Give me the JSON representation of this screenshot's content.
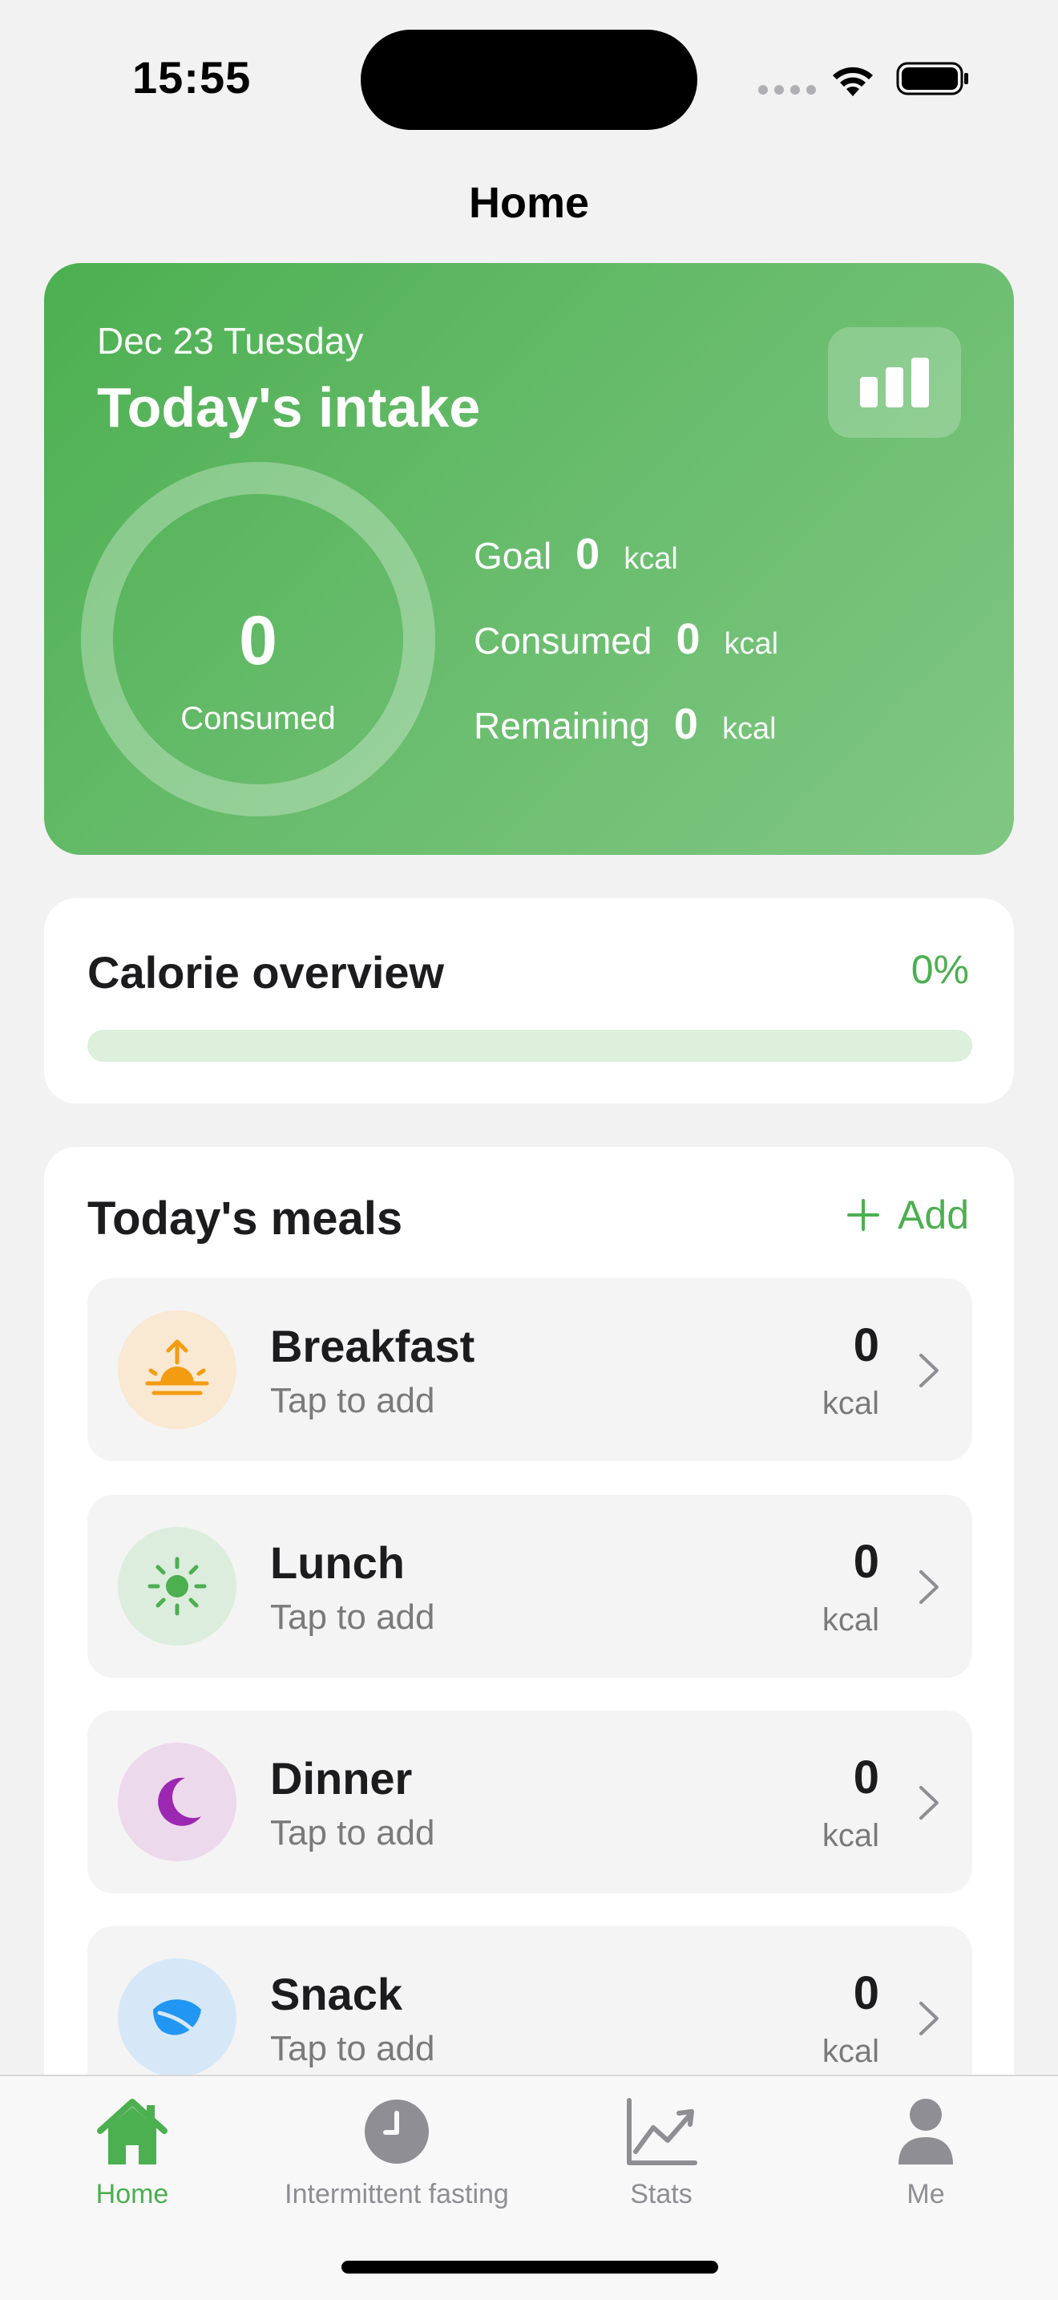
{
  "status_bar": {
    "time": "15:55"
  },
  "nav": {
    "title": "Home"
  },
  "intake": {
    "date": "Dec 23 Tuesday",
    "title": "Today's intake",
    "ring_value": "0",
    "ring_label": "Consumed",
    "consumed_fraction": 0,
    "stats": [
      {
        "label": "Goal",
        "value": "0",
        "unit": "kcal"
      },
      {
        "label": "Consumed",
        "value": "0",
        "unit": "kcal"
      },
      {
        "label": "Remaining",
        "value": "0",
        "unit": "kcal"
      }
    ]
  },
  "overview": {
    "title": "Calorie overview",
    "percent": "0%",
    "progress": 0
  },
  "meals": {
    "title": "Today's meals",
    "add_label": "Add",
    "items": [
      {
        "name": "Breakfast",
        "hint": "Tap to add",
        "kcal": "0",
        "unit": "kcal",
        "icon": "sunrise-icon",
        "bg": "#f9e8d2",
        "color": "#f39c12"
      },
      {
        "name": "Lunch",
        "hint": "Tap to add",
        "kcal": "0",
        "unit": "kcal",
        "icon": "sun-icon",
        "bg": "#dcedde",
        "color": "#4caf50"
      },
      {
        "name": "Dinner",
        "hint": "Tap to add",
        "kcal": "0",
        "unit": "kcal",
        "icon": "moon-icon",
        "bg": "#ecd9ec",
        "color": "#9c27b0"
      },
      {
        "name": "Snack",
        "hint": "Tap to add",
        "kcal": "0",
        "unit": "kcal",
        "icon": "leaf-icon",
        "bg": "#d6e8f7",
        "color": "#2196f3"
      }
    ]
  },
  "tabs": [
    {
      "label": "Home",
      "icon": "home-icon",
      "active": true
    },
    {
      "label": "Intermittent fasting",
      "icon": "clock-icon",
      "active": false
    },
    {
      "label": "Stats",
      "icon": "chart-line-icon",
      "active": false
    },
    {
      "label": "Me",
      "icon": "person-icon",
      "active": false
    }
  ],
  "colors": {
    "accent": "#4caf50",
    "inactive_tab": "#8e8e93"
  }
}
